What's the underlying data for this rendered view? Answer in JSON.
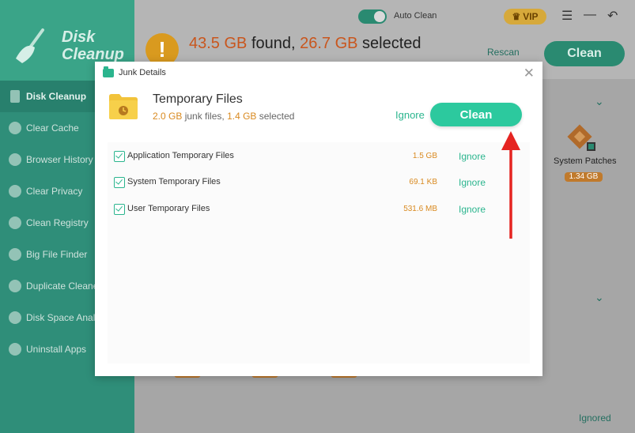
{
  "app": {
    "logo_line1": "Disk",
    "logo_line2": "Cleanup",
    "auto_clean_label": "Auto Clean",
    "vip_label": "VIP",
    "summary": {
      "found": "43.5 GB",
      "found_label": " found, ",
      "selected": "26.7 GB",
      "selected_label": " selected"
    },
    "rescan_label": "Rescan",
    "clean_label": "Clean",
    "system_patches": {
      "label": "System Patches",
      "size": "1.34 GB"
    },
    "ignored_label": "Ignored",
    "colors": {
      "sidebar": "#2f8e79",
      "accent": "#2cc99e",
      "warning": "#d99a1f",
      "highlight": "#d98a20"
    }
  },
  "sidebar": {
    "items": [
      {
        "label": "Disk Cleanup",
        "icon": "broom-icon",
        "active": true
      },
      {
        "label": "Clear Cache",
        "icon": "database-icon"
      },
      {
        "label": "Browser History",
        "icon": "globe-icon"
      },
      {
        "label": "Clear Privacy",
        "icon": "eye-icon"
      },
      {
        "label": "Clean Registry",
        "icon": "registry-icon"
      },
      {
        "label": "Big File Finder",
        "icon": "folder-icon"
      },
      {
        "label": "Duplicate Cleaner",
        "icon": "duplicate-icon"
      },
      {
        "label": "Disk Space Analyzer",
        "icon": "pie-icon"
      },
      {
        "label": "Uninstall Apps",
        "icon": "apps-icon"
      }
    ]
  },
  "modal": {
    "title": "Junk Details",
    "category": {
      "title": "Temporary Files",
      "junk_size": "2.0 GB",
      "junk_label": " junk files, ",
      "selected_size": "1.4 GB",
      "selected_label": " selected"
    },
    "ignore_label": "Ignore",
    "clean_label": "Clean",
    "rows": [
      {
        "label": "Application Temporary Files",
        "size": "1.5 GB",
        "checked": true,
        "ignore": "Ignore"
      },
      {
        "label": "System Temporary Files",
        "size": "69.1 KB",
        "checked": true,
        "ignore": "Ignore"
      },
      {
        "label": "User Temporary Files",
        "size": "531.6 MB",
        "checked": true,
        "ignore": "Ignore"
      }
    ]
  }
}
